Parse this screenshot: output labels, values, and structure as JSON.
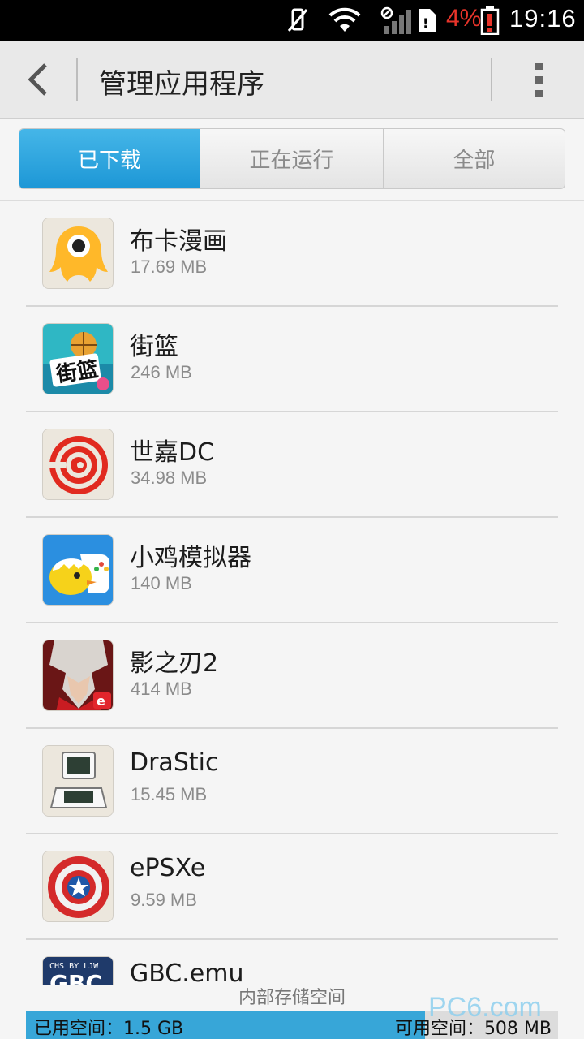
{
  "status_bar": {
    "battery_percent": "4%",
    "time": "19:16"
  },
  "action_bar": {
    "title": "管理应用程序"
  },
  "tabs": [
    {
      "label": "已下载",
      "active": true
    },
    {
      "label": "正在运行",
      "active": false
    },
    {
      "label": "全部",
      "active": false
    }
  ],
  "apps": [
    {
      "name": "布卡漫画",
      "size": "17.69 MB",
      "icon": "buka-comic-icon"
    },
    {
      "name": "街篮",
      "size": "246 MB",
      "icon": "street-basketball-icon"
    },
    {
      "name": "世嘉DC",
      "size": "34.98 MB",
      "icon": "sega-dreamcast-swirl-icon"
    },
    {
      "name": "小鸡模拟器",
      "size": "140 MB",
      "icon": "happy-chick-icon"
    },
    {
      "name": "影之刃2",
      "size": "414 MB",
      "icon": "shadow-blade-icon"
    },
    {
      "name": "DraStic",
      "size": "15.45 MB",
      "icon": "nintendo-ds-icon"
    },
    {
      "name": "ePSXe",
      "size": "9.59 MB",
      "icon": "captain-shield-icon"
    },
    {
      "name": "GBC.emu",
      "size": "",
      "icon": "gbc-icon",
      "icon_text": "GBC",
      "icon_subtext": "CHS BY LJW"
    }
  ],
  "storage": {
    "label": "内部存储空间",
    "used": "已用空间：1.5 GB",
    "free": "可用空间：508 MB",
    "used_fraction": 0.75
  },
  "watermark": "PC6.com"
}
